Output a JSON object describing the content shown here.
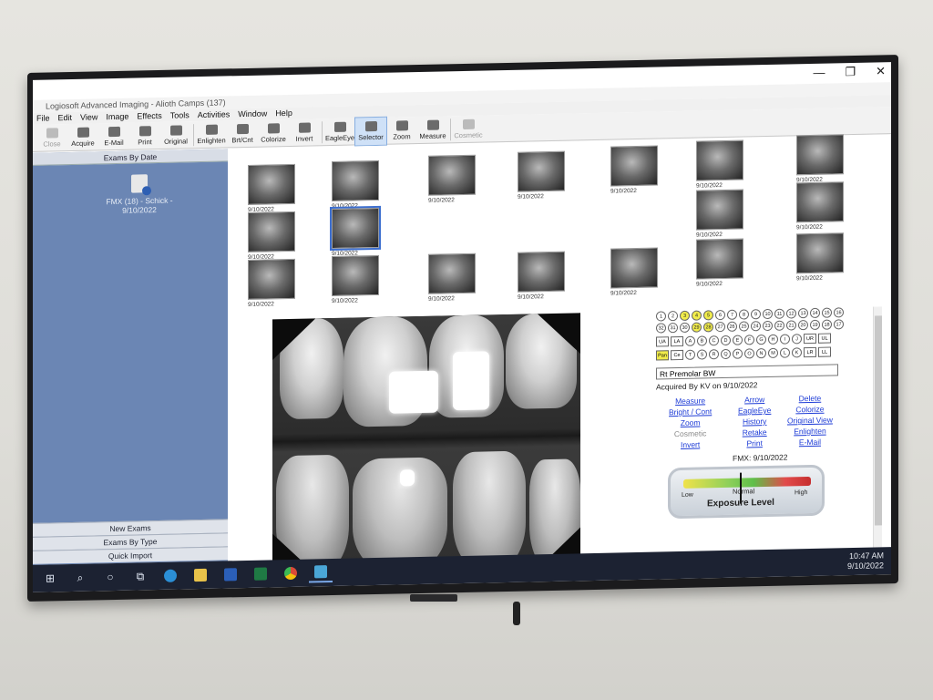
{
  "window": {
    "title": "Logiosoft Advanced Imaging - Alioth Camps (137)",
    "minimize_glyph": "—",
    "restore_glyph": "❐",
    "close_glyph": "✕"
  },
  "menu": [
    "File",
    "Edit",
    "View",
    "Image",
    "Effects",
    "Tools",
    "Activities",
    "Window",
    "Help"
  ],
  "toolbar": [
    {
      "label": "Close",
      "icon": "close-icon",
      "state": "dim"
    },
    {
      "label": "Acquire",
      "icon": "camera-icon",
      "state": "normal"
    },
    {
      "label": "E-Mail",
      "icon": "email-icon",
      "state": "normal"
    },
    {
      "label": "Print",
      "icon": "print-icon",
      "state": "normal"
    },
    {
      "label": "Original",
      "icon": "original-icon",
      "state": "normal"
    },
    {
      "label": "Enlighten",
      "icon": "enlighten-icon",
      "state": "normal"
    },
    {
      "label": "Brt/Cnt",
      "icon": "brightness-icon",
      "state": "normal"
    },
    {
      "label": "Colorize",
      "icon": "colorize-icon",
      "state": "normal"
    },
    {
      "label": "Invert",
      "icon": "invert-icon",
      "state": "normal"
    },
    {
      "label": "EagleEye",
      "icon": "eagleeye-icon",
      "state": "normal"
    },
    {
      "label": "Selector",
      "icon": "cursor-icon",
      "state": "active"
    },
    {
      "label": "Zoom",
      "icon": "zoom-icon",
      "state": "normal"
    },
    {
      "label": "Measure",
      "icon": "measure-icon",
      "state": "normal"
    },
    {
      "label": "Cosmetic",
      "icon": "cosmetic-icon",
      "state": "dim"
    }
  ],
  "left_panel": {
    "header": "Exams By Date",
    "exam_label": "FMX (18) - Schick - 9/10/2022",
    "buttons": [
      "New Exams",
      "Exams By Type",
      "Quick Import"
    ]
  },
  "thumbnail_date": "9/10/2022",
  "info": {
    "grid_row1": [
      "1",
      "2",
      "3",
      "4",
      "5",
      "6",
      "7",
      "8",
      "9",
      "10",
      "11",
      "12",
      "13",
      "14",
      "15",
      "16"
    ],
    "grid_row1_highlight": [
      "3",
      "4",
      "5"
    ],
    "grid_row2": [
      "32",
      "31",
      "30",
      "29",
      "28",
      "27",
      "26",
      "25",
      "24",
      "23",
      "22",
      "21",
      "20",
      "19",
      "18",
      "17"
    ],
    "grid_row2_highlight": [
      "29",
      "28"
    ],
    "grid_row3_left": [
      "UA",
      "LA"
    ],
    "grid_row3_letters": [
      "A",
      "B",
      "C",
      "D",
      "E",
      "F",
      "G",
      "H",
      "I",
      "J"
    ],
    "grid_row3_right": [
      "UR",
      "UL"
    ],
    "grid_row4_left": [
      "Pan",
      "Ce"
    ],
    "grid_row4_letters": [
      "T",
      "S",
      "R",
      "Q",
      "P",
      "O",
      "N",
      "M",
      "L",
      "K"
    ],
    "grid_row4_right": [
      "LR",
      "LL"
    ],
    "description": "Rt Premolar BW",
    "acquired": "Acquired By KV on 9/10/2022",
    "links_col1": [
      "Measure",
      "Bright / Cont",
      "Zoom",
      "Cosmetic",
      "Invert"
    ],
    "links_col2": [
      "Arrow",
      "EagleEye",
      "History",
      "Retake",
      "Print"
    ],
    "links_col3": [
      "Delete",
      "Colorize",
      "Original View",
      "Enlighten",
      "E-Mail"
    ],
    "fmx": "FMX: 9/10/2022",
    "gauge": {
      "low": "Low",
      "normal": "Normal",
      "high": "High",
      "title": "Exposure Level",
      "level": 0.5
    }
  },
  "taskbar": {
    "time": "10:47 AM",
    "date": "9/10/2022",
    "icons": [
      "windows-start-icon",
      "search-icon",
      "cortana-icon",
      "task-view-icon",
      "edge-icon",
      "file-explorer-icon",
      "word-icon",
      "excel-icon",
      "chrome-icon",
      "imaging-app-icon"
    ]
  }
}
